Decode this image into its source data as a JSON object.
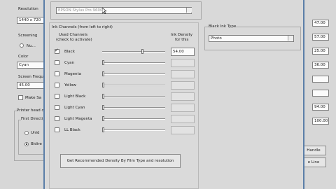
{
  "left_panel": {
    "resolution_label": "Resolution",
    "resolution_value": "1440 x 720",
    "screening_label": "Screening",
    "screening_option": "Nu...",
    "color_label": "Color",
    "color_value": "Cyan",
    "screen_freq_label": "Screen Frequ",
    "screen_freq_value": "45.00",
    "make_same_label": "Make Sa",
    "printer_head_label": "Printer head di",
    "first_direction_label": "First Directi",
    "radio_1_label": "Unid",
    "radio_2_label": "Bidire"
  },
  "dialog": {
    "printer_field": "EPSON Stylus Pro 9600",
    "ink_channels_title": "Ink Channels (from left to right)",
    "used_channels_header": "Used Channels",
    "used_channels_subheader": "(check to activate)",
    "ink_density_header": "Ink Density",
    "ink_density_subheader": "for this",
    "channels": [
      {
        "name": "Black",
        "checked": true,
        "density": "54.00",
        "level": 0.5
      },
      {
        "name": "Cyan",
        "checked": false,
        "density": "",
        "level": 0
      },
      {
        "name": "Magenta",
        "checked": false,
        "density": "",
        "level": 0
      },
      {
        "name": "Yellow",
        "checked": false,
        "density": "",
        "level": 0
      },
      {
        "name": "Light Black",
        "checked": false,
        "density": "",
        "level": 0
      },
      {
        "name": "Light Cyan",
        "checked": false,
        "density": "",
        "level": 0
      },
      {
        "name": "Light Magenta",
        "checked": false,
        "density": "",
        "level": 0
      },
      {
        "name": "LL Black",
        "checked": false,
        "density": "",
        "level": 0
      }
    ],
    "recommended_button": "Get Recommended Density By Film Type and resolution",
    "black_ink_type_label": "Black Ink Type",
    "black_ink_type_value": "Photo"
  },
  "right_panel": {
    "values": [
      "47.00",
      "57.00",
      "25.00",
      "36.00",
      "",
      "",
      "94.00",
      "100.00"
    ],
    "handle_button": "Handle",
    "line_button": "e Line"
  }
}
